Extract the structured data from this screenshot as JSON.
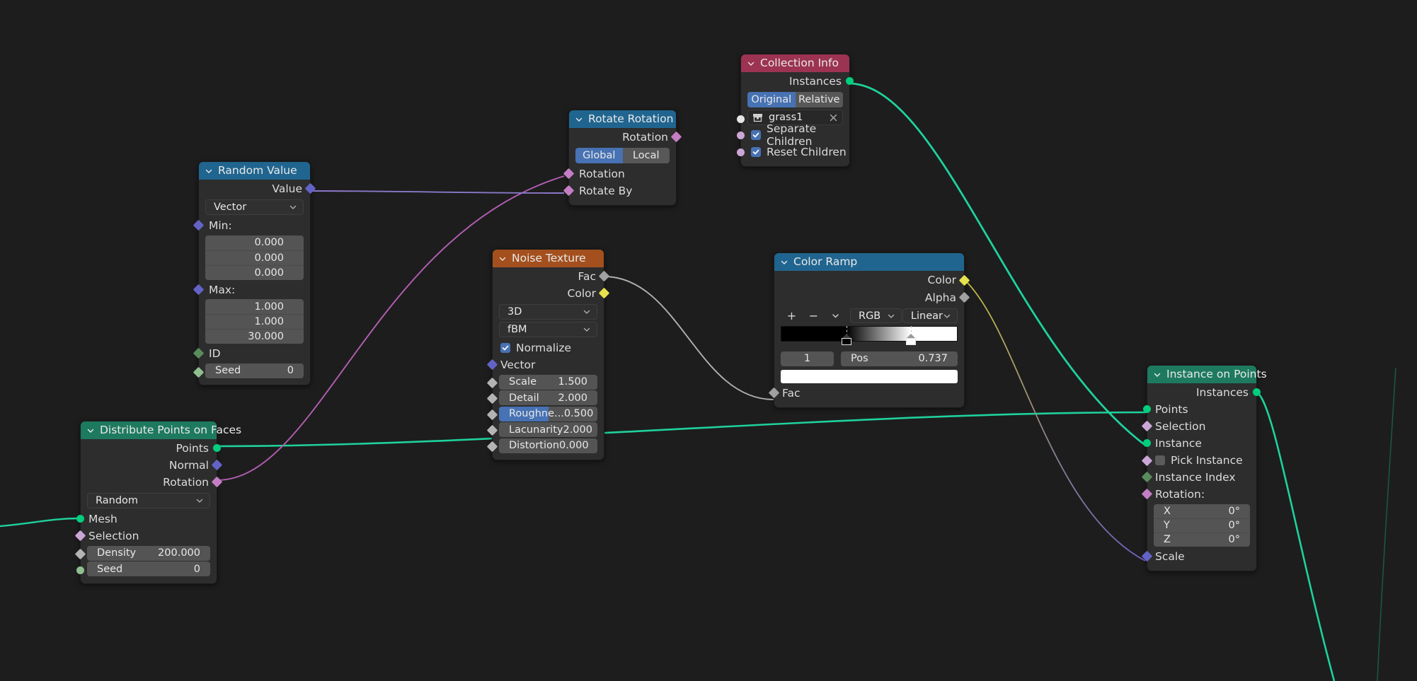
{
  "editor": {
    "background": "#1d1d1d",
    "name": "geometry-node-editor"
  },
  "nodes": {
    "random_value": {
      "title": "Random Value",
      "header_color": "#20658f",
      "outputs": [
        {
          "label": "Value",
          "socket": "vector"
        }
      ],
      "data_type": "Vector",
      "min_label": "Min:",
      "min_values": [
        "0.000",
        "0.000",
        "0.000"
      ],
      "max_label": "Max:",
      "max_values": [
        "1.000",
        "1.000",
        "30.000"
      ],
      "id_label": "ID",
      "seed_label": "Seed",
      "seed_value": "0"
    },
    "rotate_rotation": {
      "title": "Rotate Rotation",
      "header_color": "#20658f",
      "outputs": [
        {
          "label": "Rotation",
          "socket": "rotation"
        }
      ],
      "space_options": [
        "Global",
        "Local"
      ],
      "space_selected": "Global",
      "inputs": [
        {
          "label": "Rotation",
          "socket": "rotation"
        },
        {
          "label": "Rotate By",
          "socket": "rotation"
        }
      ]
    },
    "collection_info": {
      "title": "Collection Info",
      "header_color": "#9c3353",
      "outputs": [
        {
          "label": "Instances",
          "socket": "geometry"
        }
      ],
      "transform_options": [
        "Original",
        "Relative"
      ],
      "transform_selected": "Original",
      "collection_name": "grass1",
      "separate_children_label": "Separate Children",
      "separate_children_checked": true,
      "reset_children_label": "Reset Children",
      "reset_children_checked": true
    },
    "noise_texture": {
      "title": "Noise Texture",
      "header_color": "#a3501e",
      "outputs": [
        {
          "label": "Fac",
          "socket": "float"
        },
        {
          "label": "Color",
          "socket": "color"
        }
      ],
      "dimension": "3D",
      "noise_type": "fBM",
      "normalize_label": "Normalize",
      "normalize_checked": true,
      "vector_label": "Vector",
      "fields": [
        {
          "name": "Scale",
          "value": "1.500",
          "fill": 0
        },
        {
          "name": "Detail",
          "value": "2.000",
          "fill": 0
        },
        {
          "name": "Roughne...",
          "value": "0.500",
          "fill": 50
        },
        {
          "name": "Lacunarity",
          "value": "2.000",
          "fill": 0
        },
        {
          "name": "Distortion",
          "value": "0.000",
          "fill": 0
        }
      ]
    },
    "color_ramp": {
      "title": "Color Ramp",
      "header_color": "#20658f",
      "outputs": [
        {
          "label": "Color",
          "socket": "color"
        },
        {
          "label": "Alpha",
          "socket": "float"
        }
      ],
      "add_label": "+",
      "remove_label": "−",
      "menu_label": "v",
      "color_mode": "RGB",
      "interpolation": "Linear",
      "stop_index": "1",
      "pos_label": "Pos",
      "pos_value": "0.737",
      "stops": [
        {
          "pos": 0.37,
          "color": "#000000",
          "selected": false
        },
        {
          "pos": 0.737,
          "color": "#ffffff",
          "selected": true
        }
      ],
      "active_color": "#ffffff",
      "inputs": [
        {
          "label": "Fac",
          "socket": "float"
        }
      ]
    },
    "instance_on_points": {
      "title": "Instance on Points",
      "header_color": "#1e7a5e",
      "outputs": [
        {
          "label": "Instances",
          "socket": "geometry"
        }
      ],
      "inputs": [
        {
          "label": "Points",
          "socket": "geometry"
        },
        {
          "label": "Selection",
          "socket": "boolean"
        },
        {
          "label": "Instance",
          "socket": "geometry"
        },
        {
          "label": "Pick Instance",
          "socket": "boolean"
        },
        {
          "label": "Instance Index",
          "socket": "int"
        },
        {
          "label": "Rotation:",
          "socket": "rotation"
        },
        {
          "label": "Scale",
          "socket": "vector"
        }
      ],
      "pick_instance_checked": false,
      "rotation_values": [
        {
          "axis": "X",
          "value": "0°"
        },
        {
          "axis": "Y",
          "value": "0°"
        },
        {
          "axis": "Z",
          "value": "0°"
        }
      ]
    },
    "distribute_points": {
      "title": "Distribute Points on Faces",
      "header_color": "#1e7a5e",
      "outputs": [
        {
          "label": "Points",
          "socket": "geometry"
        },
        {
          "label": "Normal",
          "socket": "vector"
        },
        {
          "label": "Rotation",
          "socket": "rotation"
        }
      ],
      "method": "Random",
      "inputs": [
        {
          "label": "Mesh",
          "socket": "geometry"
        },
        {
          "label": "Selection",
          "socket": "boolean"
        }
      ],
      "fields": [
        {
          "name": "Density",
          "value": "200.000"
        },
        {
          "name": "Seed",
          "value": "0"
        }
      ]
    }
  },
  "socket_colors": {
    "geometry": "#00ce7c",
    "vector": "#6363c7",
    "rotation": "#c47ec4",
    "boolean": "#cca6d6",
    "float": "#a1a1a1",
    "color": "#e7e14f",
    "int": "#598c5c"
  },
  "wire_colors": {
    "geometry": "#1fd19c",
    "rotation": "#b45eb4",
    "vector": "#7b7bd4",
    "float": "#b0b0b0",
    "color": "#c4bd3f"
  }
}
